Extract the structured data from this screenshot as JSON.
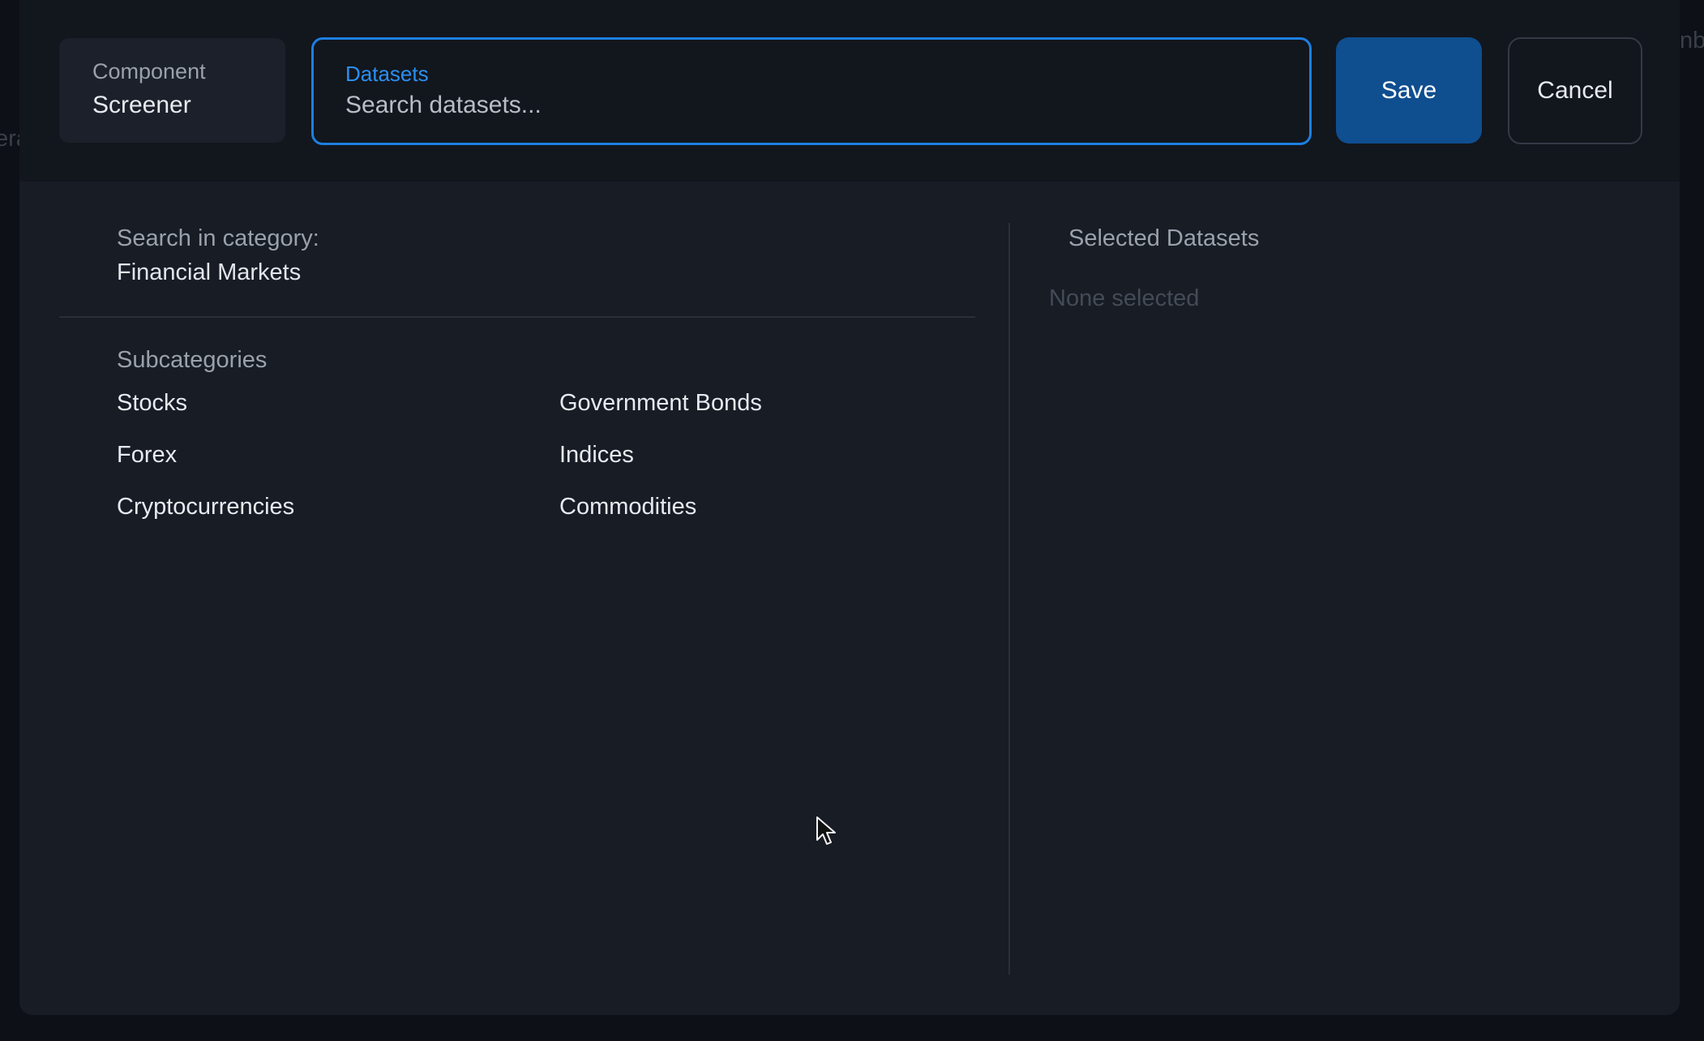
{
  "background": {
    "left_text": "era",
    "right_text": "nb"
  },
  "header": {
    "component_label": "Component",
    "component_value": "Screener",
    "datasets_label": "Datasets",
    "datasets_placeholder": "Search datasets...",
    "datasets_value": "",
    "save_label": "Save",
    "cancel_label": "Cancel"
  },
  "left_panel": {
    "search_in_category_label": "Search in category:",
    "category": "Financial Markets",
    "subcategories_heading": "Subcategories",
    "subcategories": [
      "Stocks",
      "Government Bonds",
      "Forex",
      "Indices",
      "Cryptocurrencies",
      "Commodities"
    ]
  },
  "right_panel": {
    "heading": "Selected Datasets",
    "empty_text": "None selected"
  },
  "colors": {
    "accent": "#1d7fe0",
    "save_button": "#0f4e8f",
    "dialog_bg": "#171c25",
    "header_bg": "#12161d"
  }
}
